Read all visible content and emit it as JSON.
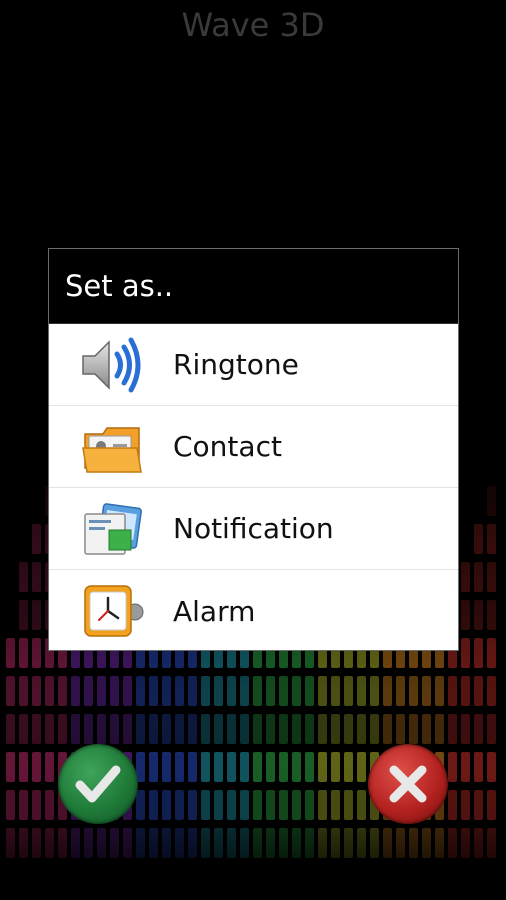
{
  "app": {
    "title": "Wave 3D"
  },
  "dialog": {
    "title": "Set as..",
    "options": [
      {
        "label": "Ringtone",
        "icon": "speaker-icon"
      },
      {
        "label": "Contact",
        "icon": "contact-card-icon"
      },
      {
        "label": "Notification",
        "icon": "notification-icon"
      },
      {
        "label": "Alarm",
        "icon": "alarm-clock-icon"
      }
    ]
  },
  "buttons": {
    "confirm": {
      "icon": "checkmark-icon",
      "color": "#1f7a38"
    },
    "cancel": {
      "icon": "close-x-icon",
      "color": "#b3221f"
    }
  },
  "colors": {
    "dialog_header": "#000000",
    "dialog_body": "#ffffff",
    "equalizer_palette": [
      "#c12a6a",
      "#7a2ab8",
      "#2a4fd0",
      "#1fa3b8",
      "#2fb84a",
      "#b8c22a",
      "#e08a1f",
      "#d0302a"
    ]
  }
}
